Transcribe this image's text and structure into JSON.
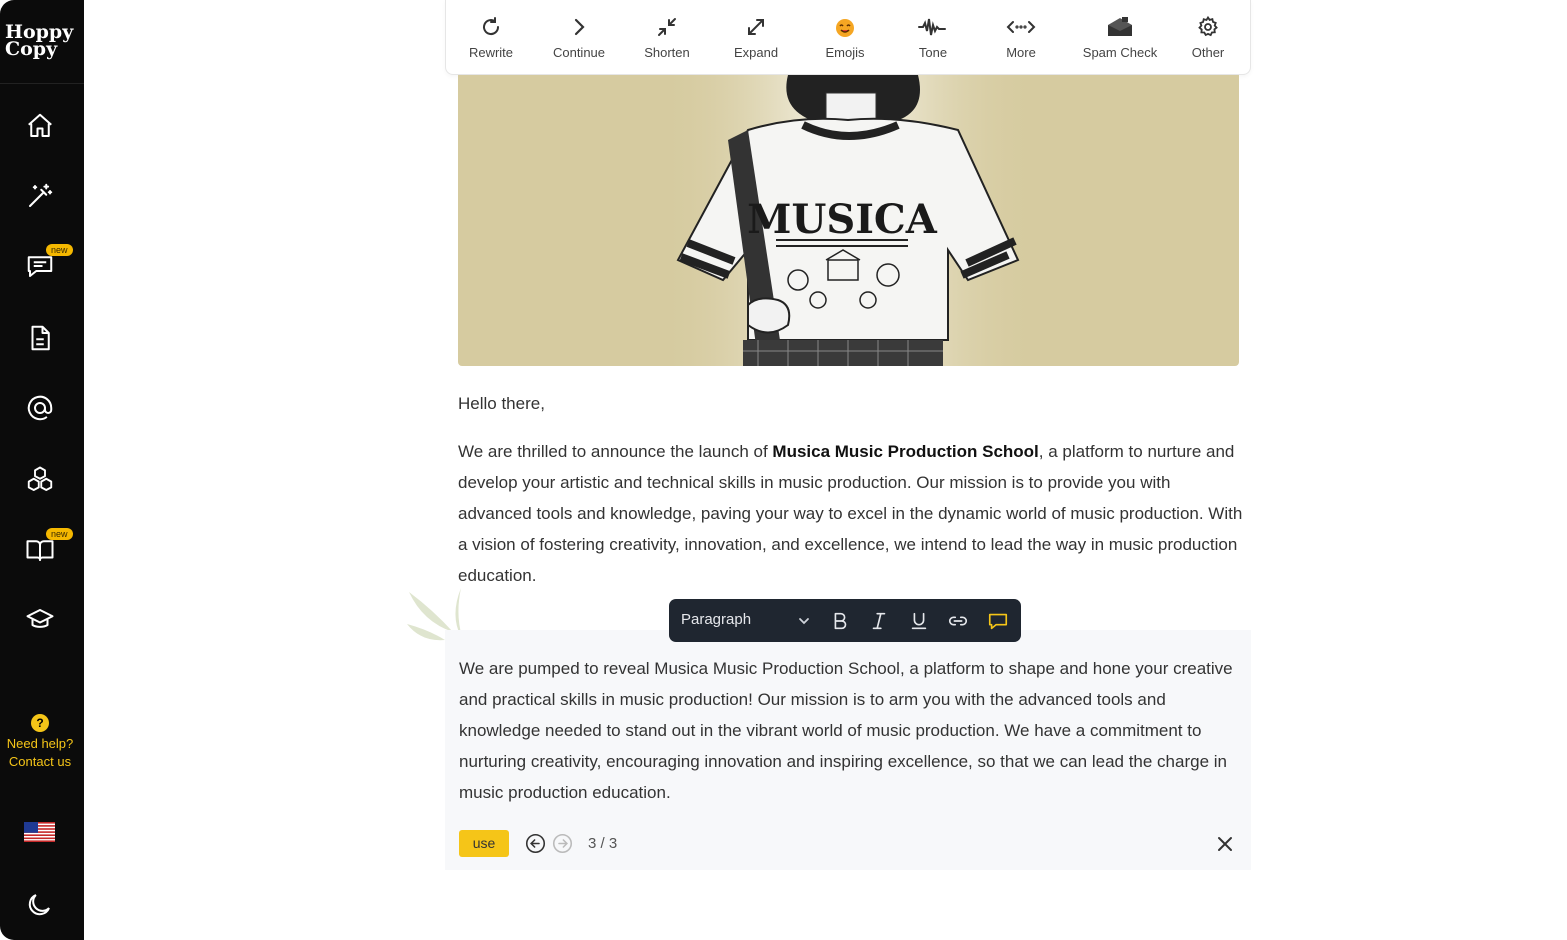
{
  "sidebar": {
    "logo": "Hoppy Copy",
    "items": [
      {
        "name": "home"
      },
      {
        "name": "magic-wand"
      },
      {
        "name": "chat",
        "badge": "new"
      },
      {
        "name": "document"
      },
      {
        "name": "at-sign"
      },
      {
        "name": "cubes"
      },
      {
        "name": "book",
        "badge": "new"
      },
      {
        "name": "graduation-cap"
      }
    ],
    "help_line1": "Need help?",
    "help_line2": "Contact us",
    "help_icon": "?"
  },
  "toolbar": {
    "tools": [
      {
        "label": "Rewrite",
        "icon": "rewrite-icon"
      },
      {
        "label": "Continue",
        "icon": "chevron-right-icon"
      },
      {
        "label": "Shorten",
        "icon": "shrink-icon"
      },
      {
        "label": "Expand",
        "icon": "expand-icon"
      },
      {
        "label": "Emojis",
        "icon": "emoji-icon"
      },
      {
        "label": "Tone",
        "icon": "waveform-icon"
      },
      {
        "label": "More",
        "icon": "code-arrows-icon"
      },
      {
        "label": "Spam Check",
        "icon": "mailbox-icon"
      },
      {
        "label": "Other",
        "icon": "gear-icon"
      }
    ]
  },
  "editor": {
    "image_text": "MUSICA",
    "greeting": "Hello there,",
    "para_before": "We are thrilled to announce the launch of ",
    "para_bold": "Musica Music Production School",
    "para_after": ", a platform to nurture and develop your artistic and technical skills in music production. Our mission is to provide you with advanced tools and knowledge, paving your way to excel in the dynamic world of music production. With a vision of fostering creativity, innovation, and excellence, we intend to lead the way in music production education."
  },
  "format_bar": {
    "block_type": "Paragraph"
  },
  "suggestion": {
    "text": "We are pumped to reveal Musica Music Production School, a platform to shape and hone your creative and practical skills in music production! Our mission is to arm you with the advanced tools and knowledge needed to stand out in the vibrant world of music production. We have a commitment to nurturing creativity, encouraging innovation and inspiring excellence, so that we can lead the charge in music production education.",
    "use_label": "use",
    "counter": "3 / 3"
  },
  "colors": {
    "accent": "#f5c518",
    "sidebar_bg": "#0b0b0b",
    "image_bg": "#d6cba0"
  }
}
